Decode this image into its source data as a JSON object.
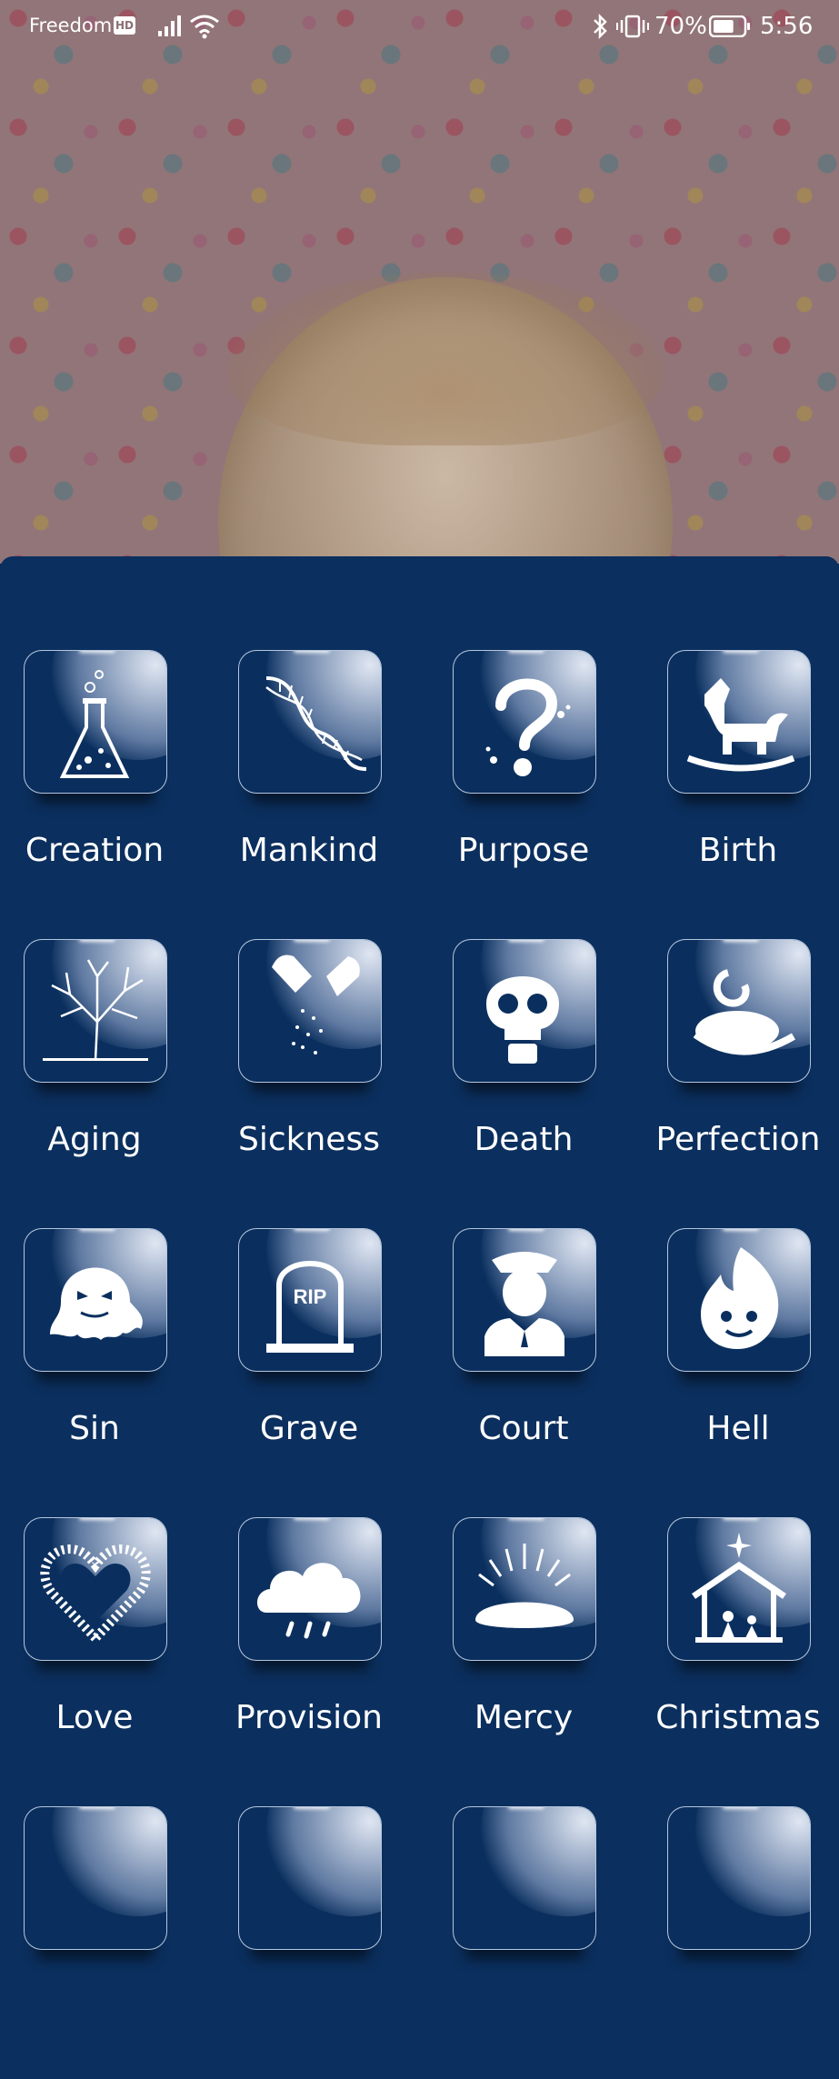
{
  "status_bar": {
    "carrier": "Freedom",
    "hd_badge": "HD",
    "battery_percent": "70%",
    "time": "5:56",
    "battery_level": 0.7
  },
  "tiles": [
    {
      "label": "Creation",
      "icon": "flask-icon"
    },
    {
      "label": "Mankind",
      "icon": "dna-icon"
    },
    {
      "label": "Purpose",
      "icon": "question-mark-icon"
    },
    {
      "label": "Birth",
      "icon": "rocking-horse-icon"
    },
    {
      "label": "Aging",
      "icon": "bare-tree-icon"
    },
    {
      "label": "Sickness",
      "icon": "pill-capsule-icon"
    },
    {
      "label": "Death",
      "icon": "skull-icon"
    },
    {
      "label": "Perfection",
      "icon": "snake-icon"
    },
    {
      "label": "Sin",
      "icon": "ghost-icon"
    },
    {
      "label": "Grave",
      "icon": "tombstone-icon"
    },
    {
      "label": "Court",
      "icon": "police-officer-icon"
    },
    {
      "label": "Hell",
      "icon": "flame-face-icon"
    },
    {
      "label": "Love",
      "icon": "heart-icon"
    },
    {
      "label": "Provision",
      "icon": "rain-cloud-icon"
    },
    {
      "label": "Mercy",
      "icon": "bread-icon"
    },
    {
      "label": "Christmas",
      "icon": "nativity-icon"
    }
  ],
  "colors": {
    "panel_background": "#0b2f5e",
    "tile_border": "#c8d7eb",
    "label_text": "#ffffff"
  }
}
